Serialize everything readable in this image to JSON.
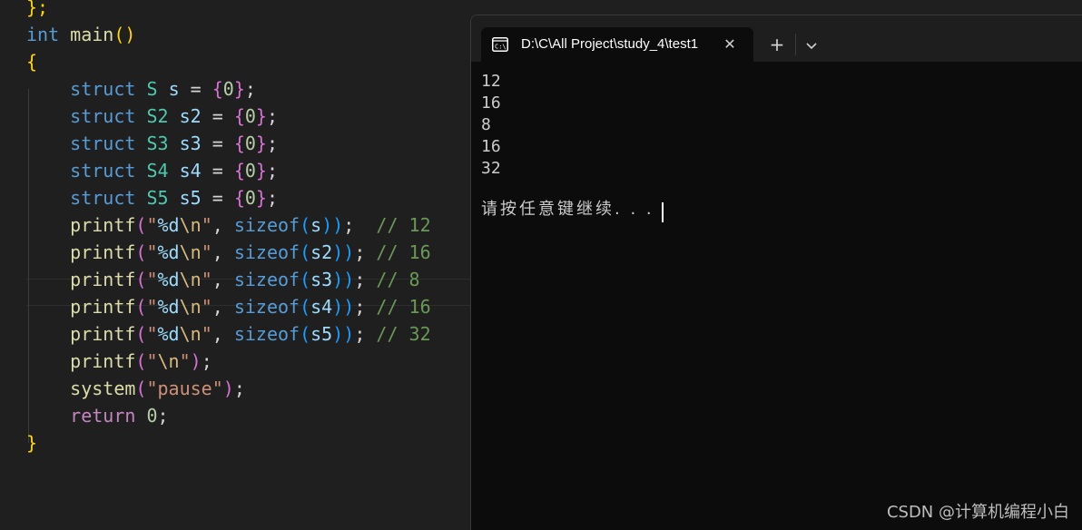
{
  "editor": {
    "lines": [
      [
        {
          "t": "};",
          "c": "b1"
        }
      ],
      [
        {
          "t": "int",
          "c": "tok-kw"
        },
        {
          "t": " "
        },
        {
          "t": "main",
          "c": "tok-fn"
        },
        {
          "t": "()",
          "c": "b1"
        }
      ],
      [
        {
          "t": "{",
          "c": "b1"
        }
      ],
      [
        {
          "t": "    "
        },
        {
          "t": "struct",
          "c": "tok-kw"
        },
        {
          "t": " "
        },
        {
          "t": "S",
          "c": "tok-type"
        },
        {
          "t": " "
        },
        {
          "t": "s",
          "c": "tok-var"
        },
        {
          "t": " = "
        },
        {
          "t": "{",
          "c": "b2"
        },
        {
          "t": "0",
          "c": "tok-num"
        },
        {
          "t": "}",
          "c": "b2"
        },
        {
          "t": ";"
        }
      ],
      [
        {
          "t": "    "
        },
        {
          "t": "struct",
          "c": "tok-kw"
        },
        {
          "t": " "
        },
        {
          "t": "S2",
          "c": "tok-type"
        },
        {
          "t": " "
        },
        {
          "t": "s2",
          "c": "tok-var"
        },
        {
          "t": " = "
        },
        {
          "t": "{",
          "c": "b2"
        },
        {
          "t": "0",
          "c": "tok-num"
        },
        {
          "t": "}",
          "c": "b2"
        },
        {
          "t": ";"
        }
      ],
      [
        {
          "t": "    "
        },
        {
          "t": "struct",
          "c": "tok-kw"
        },
        {
          "t": " "
        },
        {
          "t": "S3",
          "c": "tok-type"
        },
        {
          "t": " "
        },
        {
          "t": "s3",
          "c": "tok-var"
        },
        {
          "t": " = "
        },
        {
          "t": "{",
          "c": "b2"
        },
        {
          "t": "0",
          "c": "tok-num"
        },
        {
          "t": "}",
          "c": "b2"
        },
        {
          "t": ";"
        }
      ],
      [
        {
          "t": "    "
        },
        {
          "t": "struct",
          "c": "tok-kw"
        },
        {
          "t": " "
        },
        {
          "t": "S4",
          "c": "tok-type"
        },
        {
          "t": " "
        },
        {
          "t": "s4",
          "c": "tok-var"
        },
        {
          "t": " = "
        },
        {
          "t": "{",
          "c": "b2"
        },
        {
          "t": "0",
          "c": "tok-num"
        },
        {
          "t": "}",
          "c": "b2"
        },
        {
          "t": ";"
        }
      ],
      [
        {
          "t": "    "
        },
        {
          "t": "struct",
          "c": "tok-kw"
        },
        {
          "t": " "
        },
        {
          "t": "S5",
          "c": "tok-type"
        },
        {
          "t": " "
        },
        {
          "t": "s5",
          "c": "tok-var"
        },
        {
          "t": " = "
        },
        {
          "t": "{",
          "c": "b2"
        },
        {
          "t": "0",
          "c": "tok-num"
        },
        {
          "t": "}",
          "c": "b2"
        },
        {
          "t": ";"
        }
      ],
      [
        {
          "t": "    "
        },
        {
          "t": "printf",
          "c": "tok-fn"
        },
        {
          "t": "(",
          "c": "b2"
        },
        {
          "t": "\"",
          "c": "tok-str"
        },
        {
          "t": "%d",
          "c": "tok-var"
        },
        {
          "t": "\\n",
          "c": "tok-esc"
        },
        {
          "t": "\"",
          "c": "tok-str"
        },
        {
          "t": ", "
        },
        {
          "t": "sizeof",
          "c": "tok-kw"
        },
        {
          "t": "(",
          "c": "b3"
        },
        {
          "t": "s",
          "c": "tok-var"
        },
        {
          "t": "))",
          "c": "b3"
        },
        {
          "t": ";  "
        },
        {
          "t": "// 12",
          "c": "tok-cmt"
        }
      ],
      [
        {
          "t": "    "
        },
        {
          "t": "printf",
          "c": "tok-fn"
        },
        {
          "t": "(",
          "c": "b2"
        },
        {
          "t": "\"",
          "c": "tok-str"
        },
        {
          "t": "%d",
          "c": "tok-var"
        },
        {
          "t": "\\n",
          "c": "tok-esc"
        },
        {
          "t": "\"",
          "c": "tok-str"
        },
        {
          "t": ", "
        },
        {
          "t": "sizeof",
          "c": "tok-kw"
        },
        {
          "t": "(",
          "c": "b3"
        },
        {
          "t": "s2",
          "c": "tok-var"
        },
        {
          "t": "))",
          "c": "b3"
        },
        {
          "t": "; "
        },
        {
          "t": "// 16",
          "c": "tok-cmt"
        }
      ],
      [
        {
          "t": "    "
        },
        {
          "t": "printf",
          "c": "tok-fn"
        },
        {
          "t": "(",
          "c": "b2"
        },
        {
          "t": "\"",
          "c": "tok-str"
        },
        {
          "t": "%d",
          "c": "tok-var"
        },
        {
          "t": "\\n",
          "c": "tok-esc"
        },
        {
          "t": "\"",
          "c": "tok-str"
        },
        {
          "t": ", "
        },
        {
          "t": "sizeof",
          "c": "tok-kw"
        },
        {
          "t": "(",
          "c": "b3"
        },
        {
          "t": "s3",
          "c": "tok-var"
        },
        {
          "t": "))",
          "c": "b3"
        },
        {
          "t": "; "
        },
        {
          "t": "// 8",
          "c": "tok-cmt"
        }
      ],
      [
        {
          "t": "    "
        },
        {
          "t": "printf",
          "c": "tok-fn"
        },
        {
          "t": "(",
          "c": "b2"
        },
        {
          "t": "\"",
          "c": "tok-str"
        },
        {
          "t": "%d",
          "c": "tok-var"
        },
        {
          "t": "\\n",
          "c": "tok-esc"
        },
        {
          "t": "\"",
          "c": "tok-str"
        },
        {
          "t": ", "
        },
        {
          "t": "sizeof",
          "c": "tok-kw"
        },
        {
          "t": "(",
          "c": "b3"
        },
        {
          "t": "s4",
          "c": "tok-var"
        },
        {
          "t": "))",
          "c": "b3"
        },
        {
          "t": "; "
        },
        {
          "t": "// 16",
          "c": "tok-cmt"
        }
      ],
      [
        {
          "t": "    "
        },
        {
          "t": "printf",
          "c": "tok-fn"
        },
        {
          "t": "(",
          "c": "b2"
        },
        {
          "t": "\"",
          "c": "tok-str"
        },
        {
          "t": "%d",
          "c": "tok-var"
        },
        {
          "t": "\\n",
          "c": "tok-esc"
        },
        {
          "t": "\"",
          "c": "tok-str"
        },
        {
          "t": ", "
        },
        {
          "t": "sizeof",
          "c": "tok-kw"
        },
        {
          "t": "(",
          "c": "b3"
        },
        {
          "t": "s5",
          "c": "tok-var"
        },
        {
          "t": "))",
          "c": "b3"
        },
        {
          "t": "; "
        },
        {
          "t": "// 32",
          "c": "tok-cmt"
        }
      ],
      [
        {
          "t": "    "
        },
        {
          "t": "printf",
          "c": "tok-fn"
        },
        {
          "t": "(",
          "c": "b2"
        },
        {
          "t": "\"",
          "c": "tok-str"
        },
        {
          "t": "\\n",
          "c": "tok-esc"
        },
        {
          "t": "\"",
          "c": "tok-str"
        },
        {
          "t": ")",
          "c": "b2"
        },
        {
          "t": ";"
        }
      ],
      [
        {
          "t": "    "
        },
        {
          "t": "system",
          "c": "tok-fn"
        },
        {
          "t": "(",
          "c": "b2"
        },
        {
          "t": "\"pause\"",
          "c": "tok-str"
        },
        {
          "t": ")",
          "c": "b2"
        },
        {
          "t": ";"
        }
      ],
      [
        {
          "t": "    "
        },
        {
          "t": "return",
          "c": "tok-ctrl"
        },
        {
          "t": " "
        },
        {
          "t": "0",
          "c": "tok-num"
        },
        {
          "t": ";"
        }
      ],
      [
        {
          "t": "}",
          "c": "b1"
        }
      ]
    ]
  },
  "terminal": {
    "tab_title": "D:\\C\\All Project\\study_4\\test1",
    "close_symbol": "✕",
    "new_tab_symbol": "+",
    "output": [
      "12",
      "16",
      "8",
      "16",
      "32",
      "",
      "请按任意键继续. . . "
    ]
  },
  "watermark": "CSDN @计算机编程小白",
  "colors": {
    "editor_bg": "#1f1f1f",
    "terminal_bg": "#0c0c0c",
    "tabbar_bg": "#1e1e1e"
  }
}
